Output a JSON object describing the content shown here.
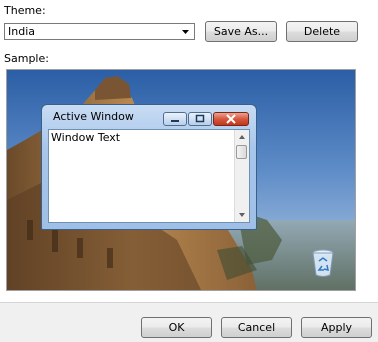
{
  "theme": {
    "label": "Theme:",
    "selected": "India"
  },
  "buttons": {
    "save_as": "Save As...",
    "delete": "Delete",
    "ok": "OK",
    "cancel": "Cancel",
    "apply": "Apply"
  },
  "sample": {
    "label": "Sample:",
    "window_title": "Active Window",
    "window_text": "Window Text"
  },
  "icons": {
    "combo_arrow": "chevron-down-icon",
    "minimize": "minimize-icon",
    "maximize": "maximize-icon",
    "close": "close-icon",
    "recycle_bin": "recycle-bin-icon"
  }
}
